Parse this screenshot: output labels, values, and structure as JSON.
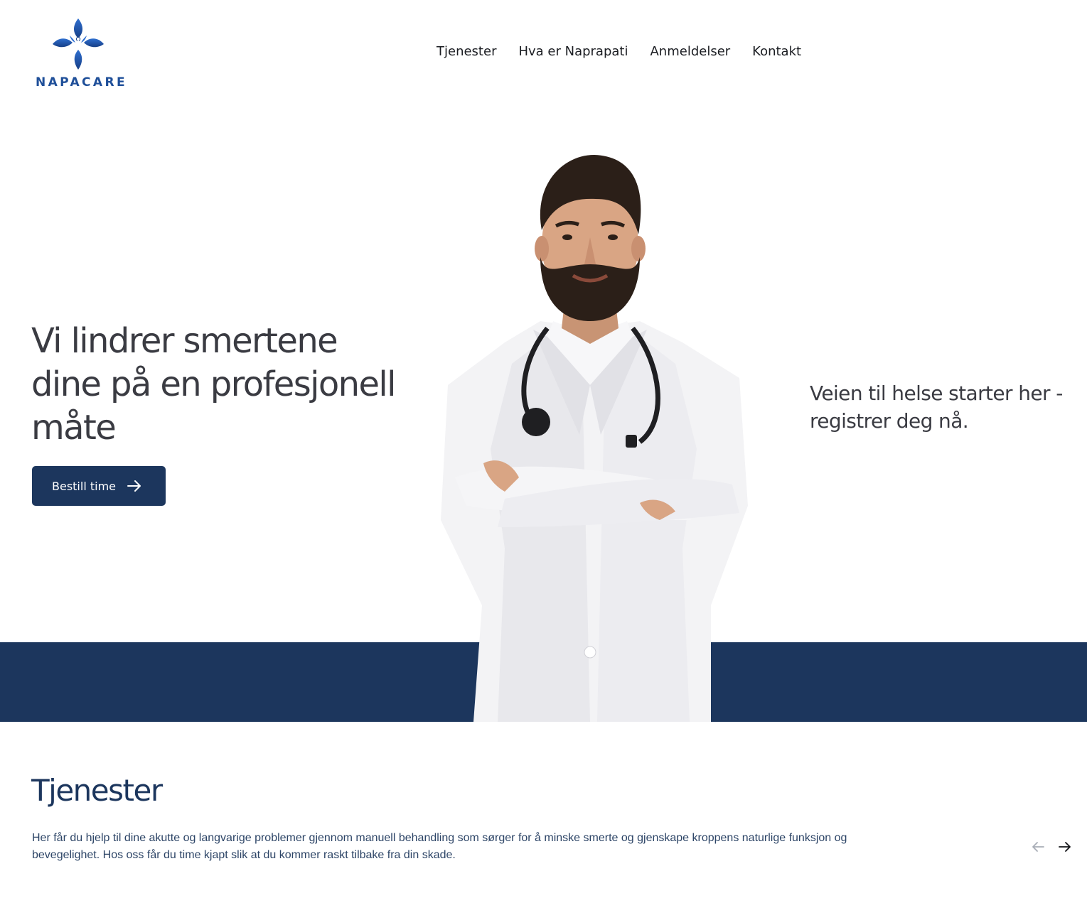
{
  "brand": {
    "name": "NAPACARE",
    "color": "#1f4f99"
  },
  "nav": {
    "items": [
      "Tjenester",
      "Hva er Naprapati",
      "Anmeldelser",
      "Kontakt"
    ]
  },
  "hero": {
    "title": "Vi lindrer smertene dine på en profesjonell måte",
    "button_label": "Bestill time",
    "button_icon": "arrow-right-icon",
    "side_text": "Veien til helse starter her - registrer deg nå.",
    "band_color": "#1c365d"
  },
  "services": {
    "title": "Tjenester",
    "text": "Her får du hjelp til dine akutte og langvarige problemer gjennom manuell behandling som sørger for å minske smerte og gjenskape kroppens naturlige funksjon og bevegelighet. Hos oss får du time kjapt slik at du kommer raskt tilbake fra din skade.",
    "prev_icon": "arrow-left-icon",
    "next_icon": "arrow-right-icon"
  }
}
